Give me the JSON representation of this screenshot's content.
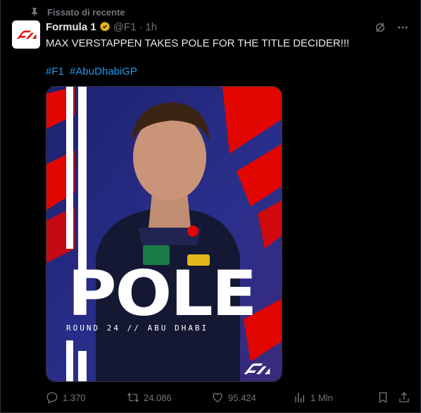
{
  "pinned": {
    "label": "Fissato di recente"
  },
  "author": {
    "name": "Formula 1",
    "handle": "@F1",
    "separator": "·",
    "time": "1h"
  },
  "tweet": {
    "text": "MAX VERSTAPPEN TAKES POLE FOR THE TITLE DECIDER!!!",
    "hashtags": [
      "#F1",
      "#AbuDhabiGP"
    ]
  },
  "media": {
    "headline": "POLE",
    "subline": "ROUND 24  //  ABU DHABI"
  },
  "metrics": {
    "replies": "1.370",
    "retweets": "24.086",
    "likes": "95.424",
    "views": "1 Mln"
  },
  "colors": {
    "accent": "#1d9bf0",
    "muted": "#71767b",
    "verified": "#e2b719",
    "f1_red": "#e10600",
    "poster_blue": "#2a2f8c"
  }
}
